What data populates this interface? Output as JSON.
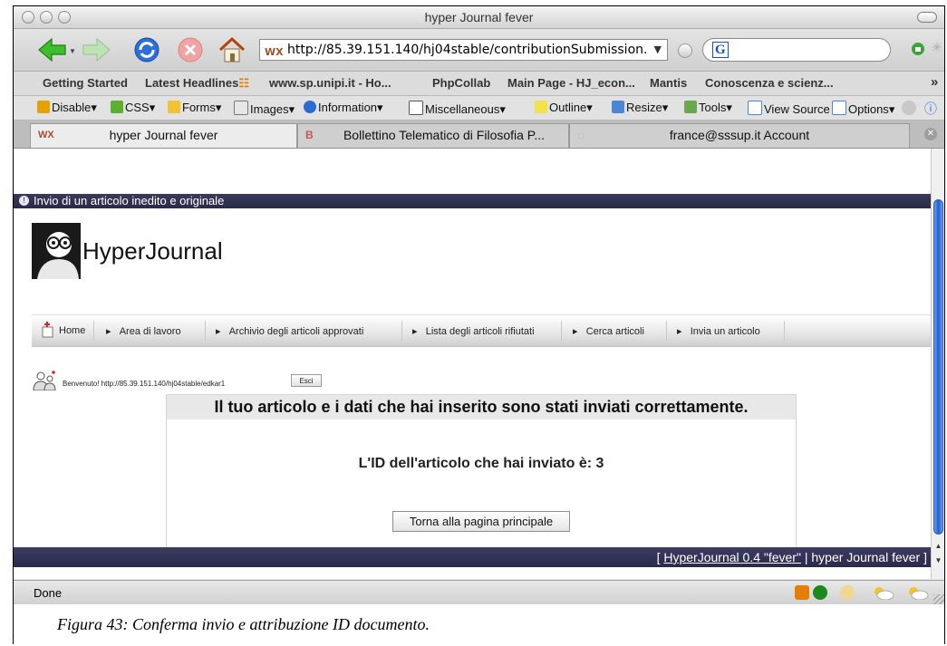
{
  "window": {
    "title": "hyper Journal fever"
  },
  "navigation": {
    "url": "http://85.39.151.140/hj04stable/contributionSubmission.",
    "url_dropdown": "▼",
    "search_engine": "G"
  },
  "bookmarks": {
    "items": [
      "Getting Started",
      "Latest Headlines",
      "www.sp.unipi.it - Ho...",
      "PhpCollab",
      "Main Page - HJ_econ...",
      "Mantis",
      "Conoscenza e scienz..."
    ],
    "overflow": "»"
  },
  "devtoolbar": {
    "items": [
      "Disable",
      "CSS",
      "Forms",
      "Images",
      "Information",
      "Miscellaneous",
      "Outline",
      "Resize",
      "Tools",
      "View Source",
      "Options"
    ]
  },
  "tabs": [
    {
      "label": "hyper Journal fever",
      "active": true
    },
    {
      "label": "Bollettino Telematico di Filosofia P...",
      "active": false
    },
    {
      "label": "france@sssup.it Account",
      "active": false
    }
  ],
  "page": {
    "header_band": "Invio di un articolo inedito e originale",
    "logo_text": "HyperJournal",
    "menu": [
      "Home",
      "Area di lavoro",
      "Archivio degli articoli approvati",
      "Lista degli articoli rifiutati",
      "Cerca articoli",
      "Invia un articolo"
    ],
    "welcome_text": "Benvenuto! http://85.39.151.140/hj04stable/edkar1",
    "logout_label": "Esci",
    "message": {
      "title": "Il tuo articolo e i dati che hai inserito sono stati inviati correttamente.",
      "id_text": "L'ID dell'articolo che hai inviato è:  3",
      "button_label": "Torna alla pagina principale"
    },
    "footer": {
      "open": "[",
      "link": "HyperJournal 0.4 \"fever\"",
      "rest": "| hyper Journal fever ]"
    }
  },
  "status": {
    "text": "Done"
  },
  "caption": "Figura 43: Conferma invio e attribuzione ID documento.",
  "colors": {
    "header_band": "#2a2a48",
    "scroll_thumb": "#1e5fd6",
    "back_arrow": "#3bbf2a"
  }
}
